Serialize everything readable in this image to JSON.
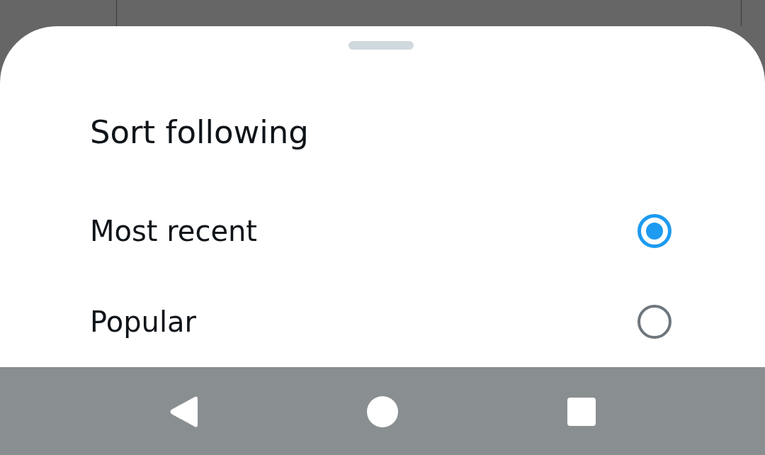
{
  "sheet": {
    "title": "Sort following",
    "options": [
      {
        "label": "Most recent",
        "selected": true
      },
      {
        "label": "Popular",
        "selected": false
      }
    ]
  },
  "nav_bar": {
    "buttons": [
      {
        "kind": "back"
      },
      {
        "kind": "home"
      },
      {
        "kind": "recents"
      }
    ]
  }
}
